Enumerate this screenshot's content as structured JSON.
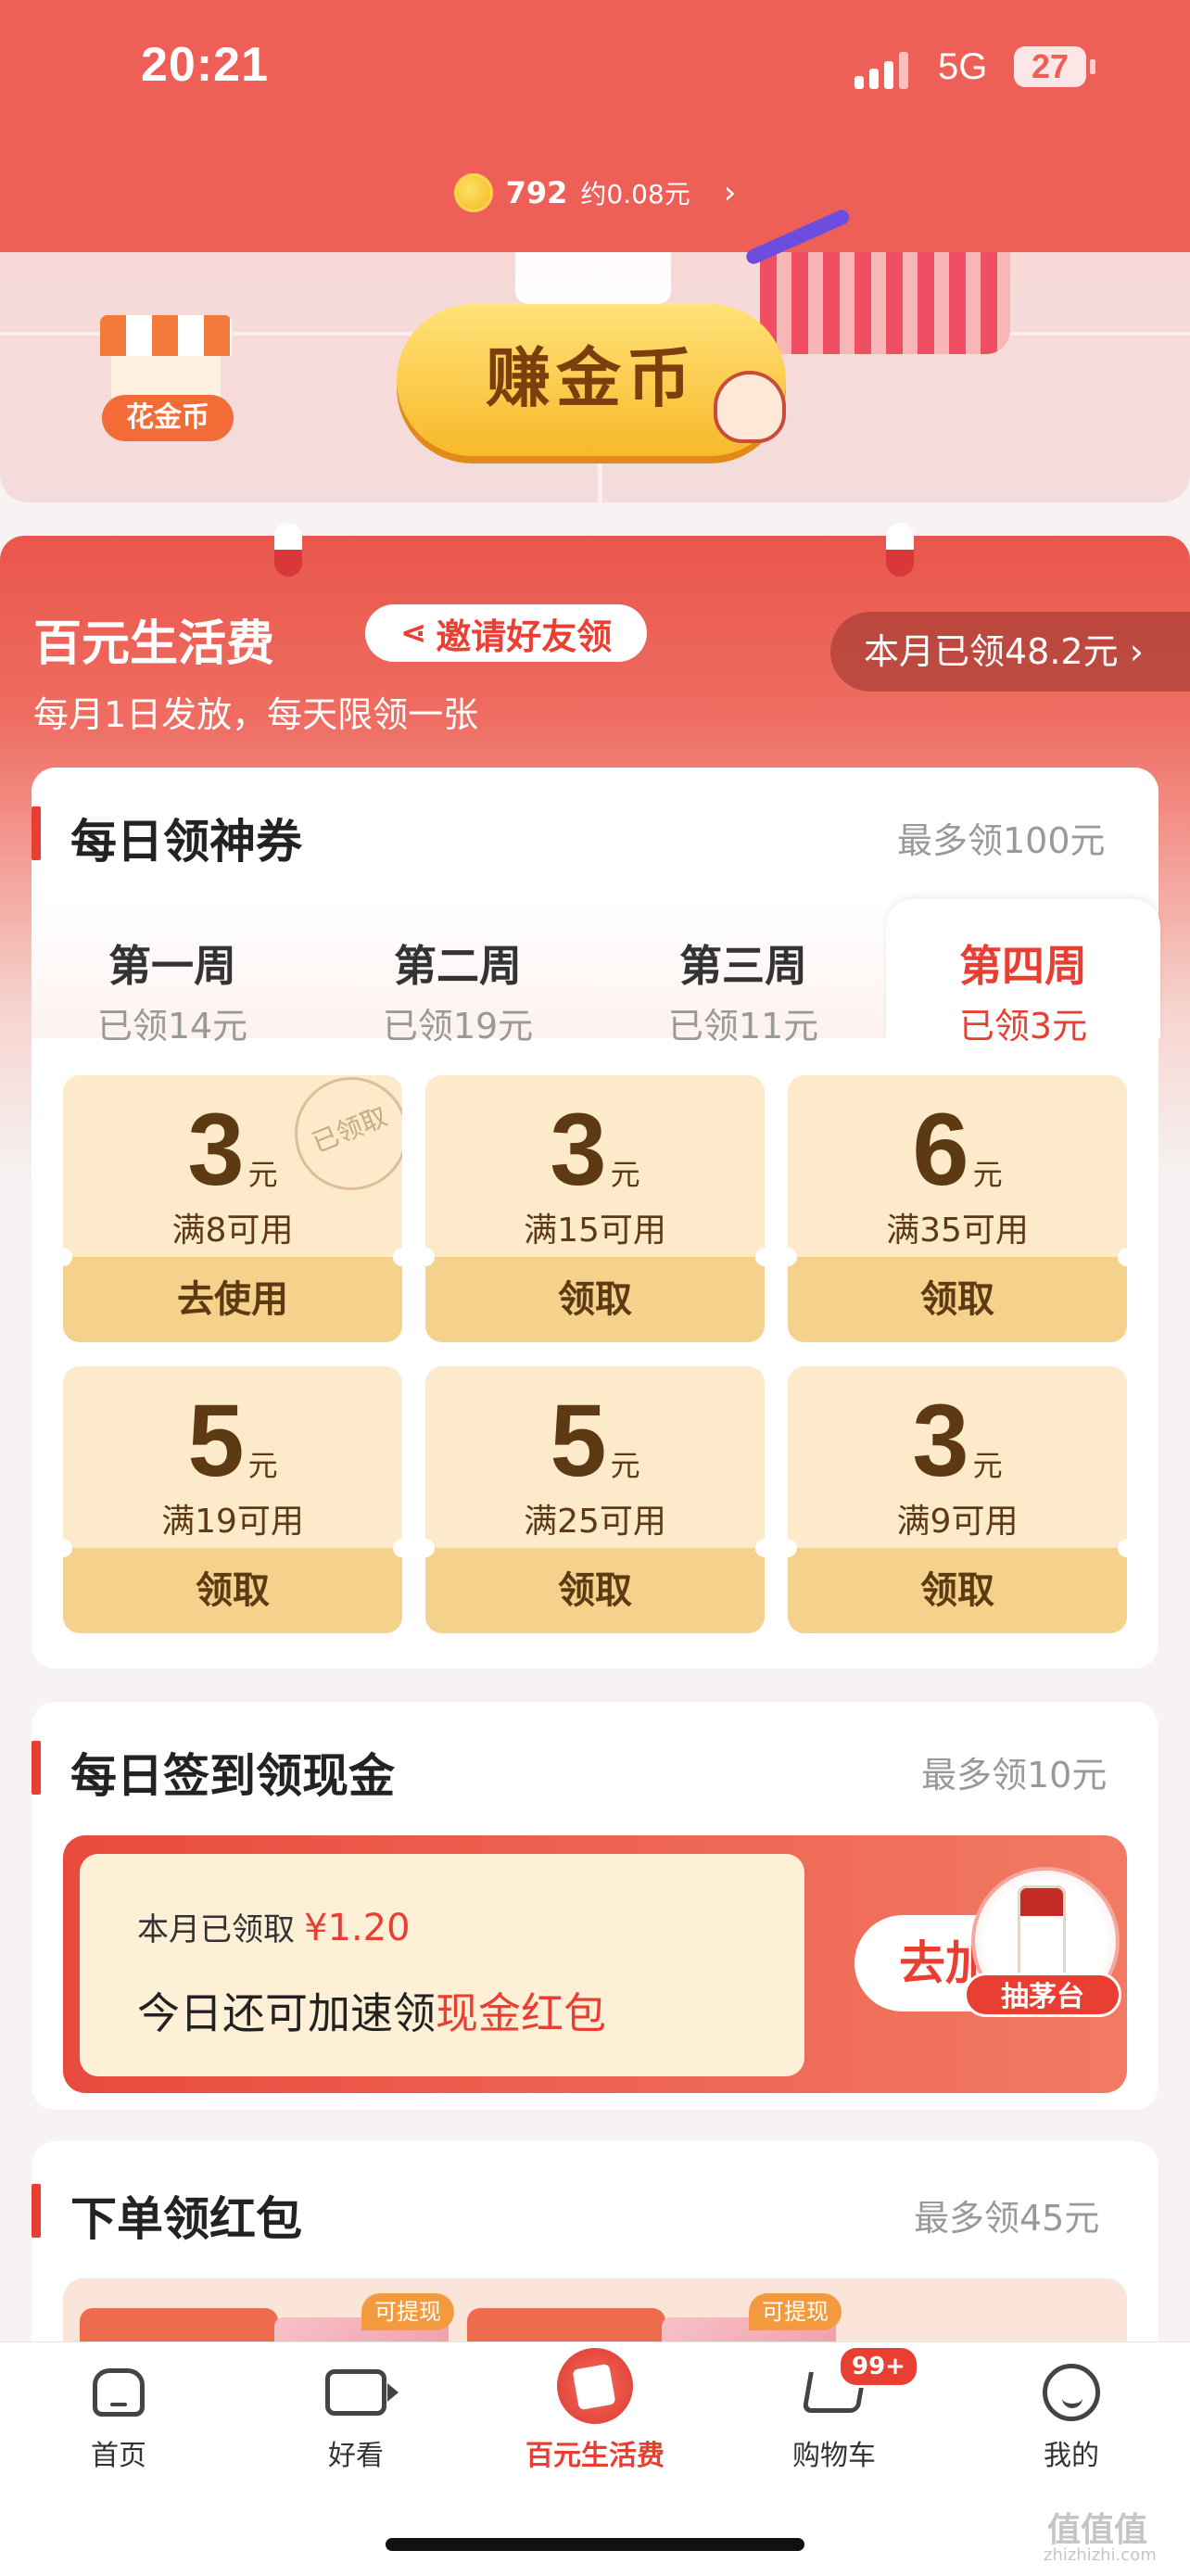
{
  "status_bar": {
    "time": "20:21",
    "network": "5G",
    "battery": "27"
  },
  "coins": {
    "count": "792",
    "equivalent": "约0.08元",
    "arrow": "›"
  },
  "banner": {
    "shop_label": "花金币",
    "earn_button": "赚金币"
  },
  "hero": {
    "title": "百元生活费",
    "invite_label": "邀请好友领",
    "subtitle": "每月1日发放，每天限领一张",
    "claimed_label": "本月已领48.2元 ›"
  },
  "daily_coupons": {
    "title": "每日领神券",
    "max": "最多领100元",
    "weeks": [
      {
        "name": "第一周",
        "amount": "已领14元"
      },
      {
        "name": "第二周",
        "amount": "已领19元"
      },
      {
        "name": "第三周",
        "amount": "已领11元"
      },
      {
        "name": "第四周",
        "amount": "已领3元"
      }
    ],
    "active_week": "第四周",
    "unit": "元",
    "stamp": "已领取",
    "coupons": [
      {
        "value": "3",
        "condition": "满8可用",
        "action": "去使用",
        "claimed": true
      },
      {
        "value": "3",
        "condition": "满15可用",
        "action": "领取",
        "claimed": false
      },
      {
        "value": "6",
        "condition": "满35可用",
        "action": "领取",
        "claimed": false
      },
      {
        "value": "5",
        "condition": "满19可用",
        "action": "领取",
        "claimed": false
      },
      {
        "value": "5",
        "condition": "满25可用",
        "action": "领取",
        "claimed": false
      },
      {
        "value": "3",
        "condition": "满9可用",
        "action": "领取",
        "claimed": false
      }
    ]
  },
  "daily_checkin": {
    "title": "每日签到领现金",
    "max": "最多领10元",
    "month_claimed_label": "本月已领取",
    "month_claimed_amount": "¥1.20",
    "line2_prefix": "今日还可加速领",
    "line2_highlight": "现金红包",
    "speed_button": "去加速",
    "maotai_label": "抽茅台"
  },
  "order_redpack": {
    "title": "下单领红包",
    "max": "最多领45元",
    "tag": "可提现"
  },
  "tabbar": {
    "items": [
      {
        "label": "首页",
        "icon": "home-icon"
      },
      {
        "label": "好看",
        "icon": "video-icon"
      },
      {
        "label": "百元生活费",
        "icon": "living-allowance-icon"
      },
      {
        "label": "购物车",
        "icon": "cart-icon"
      },
      {
        "label": "我的",
        "icon": "profile-icon"
      }
    ],
    "active": "百元生活费",
    "cart_badge": "99+"
  },
  "watermark": {
    "logo": "值值值",
    "site": "zhizhizhi.com"
  },
  "colors": {
    "brand_red": "#e83f32",
    "header_red": "#ee5f58",
    "coupon_bg": "#fceacb"
  }
}
